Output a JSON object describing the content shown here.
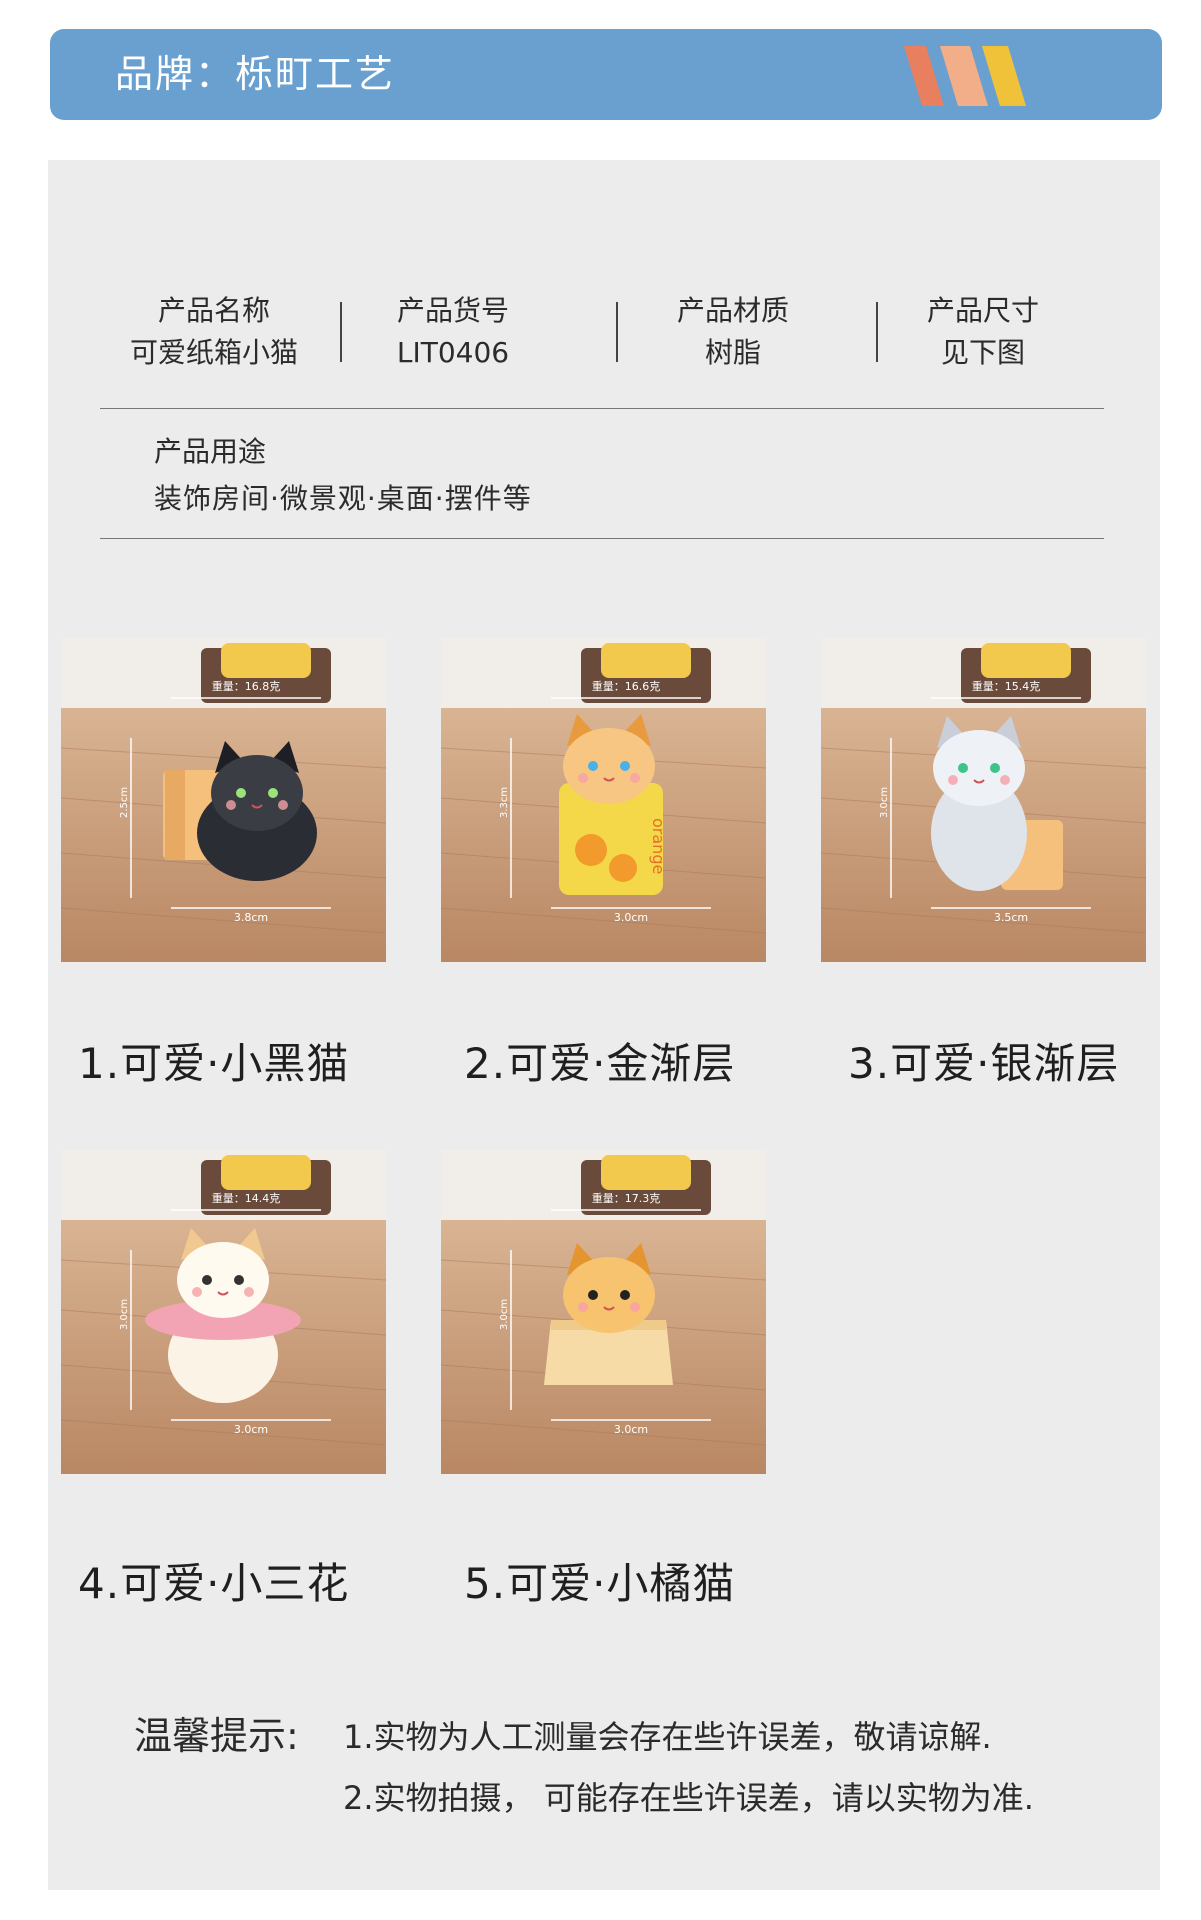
{
  "brand": {
    "text": "品牌：栎町工艺"
  },
  "colors": {
    "banner": "#6aa0d0",
    "stripe1": "#e8805f",
    "stripe2": "#f2ae88",
    "stripe3": "#f0c23a",
    "panel": "#ececec"
  },
  "specs": [
    {
      "label": "产品名称",
      "value": "可爱纸箱小猫"
    },
    {
      "label": "产品货号",
      "value": "LIT0406"
    },
    {
      "label": "产品材质",
      "value": "树脂"
    },
    {
      "label": "产品尺寸",
      "value": "见下图"
    }
  ],
  "usage": {
    "label": "产品用途",
    "value": "装饰房间·微景观·桌面·摆件等"
  },
  "products": [
    {
      "caption": "1.可爱·小黑猫",
      "weight": "重量：16.8克",
      "height": "2.5cm",
      "width": "3.8cm",
      "color": "black"
    },
    {
      "caption": "2.可爱·金渐层",
      "weight": "重量：16.6克",
      "height": "3.3cm",
      "width": "3.0cm",
      "color": "orange",
      "box_text": "orange"
    },
    {
      "caption": "3.可爱·银渐层",
      "weight": "重量：15.4克",
      "height": "3.0cm",
      "width": "3.5cm",
      "color": "silver"
    },
    {
      "caption": "4.可爱·小三花",
      "weight": "重量：14.4克",
      "height": "3.0cm",
      "width": "3.0cm",
      "color": "calico"
    },
    {
      "caption": "5.可爱·小橘猫",
      "weight": "重量：17.3克",
      "height": "3.0cm",
      "width": "3.0cm",
      "color": "ginger"
    }
  ],
  "tips": {
    "label": "温馨提示:",
    "lines": [
      "1.实物为人工测量会存在些许误差，敬请谅解.",
      "2.实物拍摄，  可能存在些许误差，请以实物为准."
    ]
  }
}
